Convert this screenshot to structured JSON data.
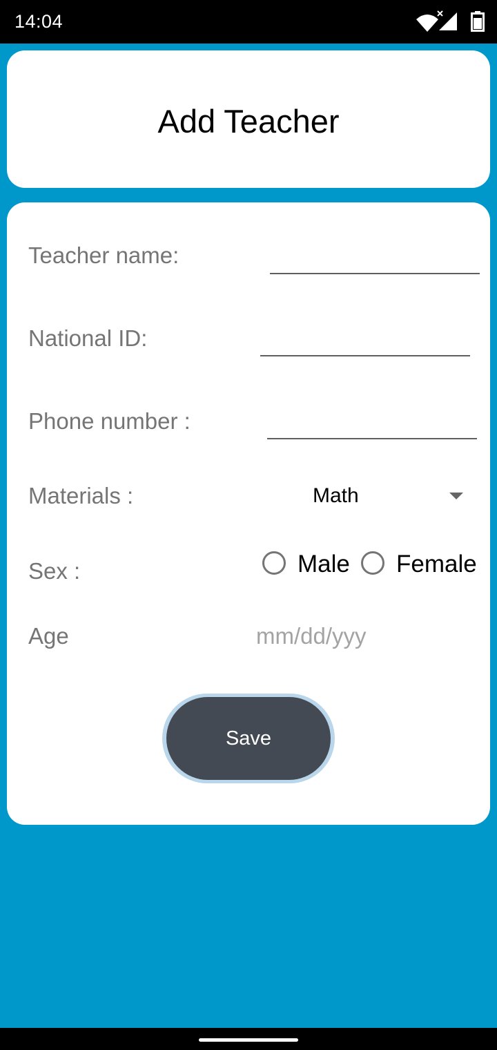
{
  "status": {
    "time": "14:04"
  },
  "header": {
    "title": "Add Teacher"
  },
  "form": {
    "teacher_name_label": "Teacher name:",
    "teacher_name_value": "",
    "national_id_label": "National ID:",
    "national_id_value": "",
    "phone_label": "Phone number :",
    "phone_value": "",
    "materials_label": "Materials :",
    "materials_selected": "Math",
    "sex_label": "Sex :",
    "sex_options": [
      "Male",
      "Female"
    ],
    "age_label": "Age",
    "age_placeholder": "mm/dd/yyy",
    "save_label": "Save"
  },
  "colors": {
    "background": "#0097cb",
    "button": "#434a53",
    "label_gray": "#757575"
  },
  "icons": [
    "wifi-icon",
    "signal-icon",
    "battery-icon",
    "dropdown-arrow-icon"
  ]
}
